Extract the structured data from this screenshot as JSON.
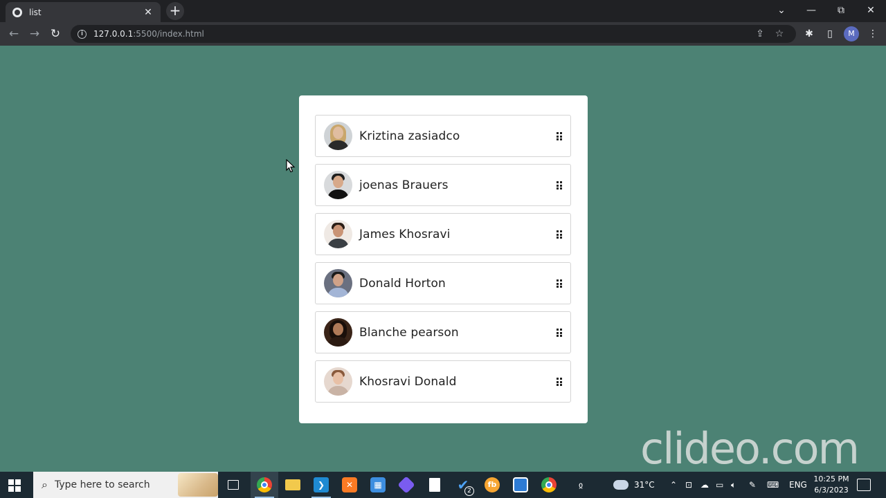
{
  "browser": {
    "tab": {
      "title": "list",
      "close": "✕"
    },
    "new_tab": "+",
    "window_controls": {
      "list_tabs": "⌄",
      "minimize": "—",
      "restore": "⧉",
      "close": "✕"
    },
    "nav": {
      "back": "←",
      "forward": "→",
      "reload": "↻"
    },
    "address": {
      "host": "127.0.0.1",
      "path": ":5500/index.html",
      "info_icon": "i"
    },
    "omnibox_icons": {
      "share": "⇪",
      "bookmark": "☆"
    },
    "toolbar_icons": {
      "extensions": "✱",
      "side_panel": "▯",
      "menu": "⋮"
    },
    "profile_initial": "M"
  },
  "page": {
    "background": "#4c8274",
    "users": [
      {
        "name": "Kriztina zasiadco",
        "avatar": "avatar-kriztina"
      },
      {
        "name": "joenas Brauers",
        "avatar": "avatar-joenas"
      },
      {
        "name": "James Khosravi",
        "avatar": "avatar-james"
      },
      {
        "name": "Donald Horton",
        "avatar": "avatar-donald"
      },
      {
        "name": "Blanche pearson",
        "avatar": "avatar-blanche"
      },
      {
        "name": "Khosravi Donald",
        "avatar": "avatar-khosravi"
      }
    ]
  },
  "watermark": "clideo.com",
  "taskbar": {
    "search_placeholder": "Type here to search",
    "badge_count": "2",
    "weather": "31°C",
    "language": "ENG",
    "time": "10:25 PM",
    "date": "6/3/2023"
  }
}
